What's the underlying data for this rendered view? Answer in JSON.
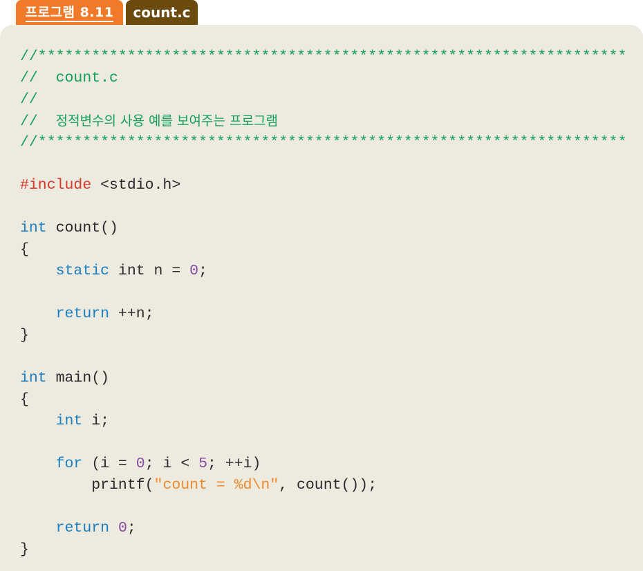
{
  "header": {
    "program_label": "프로그램 8.11",
    "file_name": "count.c"
  },
  "colors": {
    "label_tab": "#f07a2a",
    "file_tab": "#6b4a0e",
    "panel_bg": "#edeae0",
    "comment": "#13a05a",
    "preprocessor": "#d8382b",
    "keyword": "#1a7fc1",
    "number": "#8a4aa0",
    "string": "#f08a2a",
    "plain": "#2a2a2a"
  },
  "code": {
    "l1_comment": "//******************************************************************",
    "l2_comment": "//  count.c",
    "l3_comment": "//",
    "l4_prefix": "//  ",
    "l4_korean": "정적변수의 사용 예를 보여주는 프로그램",
    "l5_comment": "//******************************************************************",
    "l7_pp": "#include",
    "l7_rest": " <stdio.h>",
    "l9_kw": "int",
    "l9_rest": " count()",
    "l10": "{",
    "l11_indent": "    ",
    "l11_kw": "static",
    "l11_mid": " int n = ",
    "l11_num": "0",
    "l11_end": ";",
    "l13_indent": "    ",
    "l13_kw": "return",
    "l13_rest": " ++n;",
    "l14": "}",
    "l16_kw": "int",
    "l16_rest": " main()",
    "l17": "{",
    "l18_indent": "    ",
    "l18_kw": "int",
    "l18_rest": " i;",
    "l20_indent": "    ",
    "l20_kw": "for",
    "l20_a": " (i = ",
    "l20_num1": "0",
    "l20_b": "; i < ",
    "l20_num2": "5",
    "l20_c": "; ++i)",
    "l21_indent": "        ",
    "l21_a": "printf(",
    "l21_str": "\"count = %d\\n\"",
    "l21_b": ", count());",
    "l23_indent": "    ",
    "l23_kw": "return",
    "l23_sp": " ",
    "l23_num": "0",
    "l23_end": ";",
    "l24": "}"
  }
}
